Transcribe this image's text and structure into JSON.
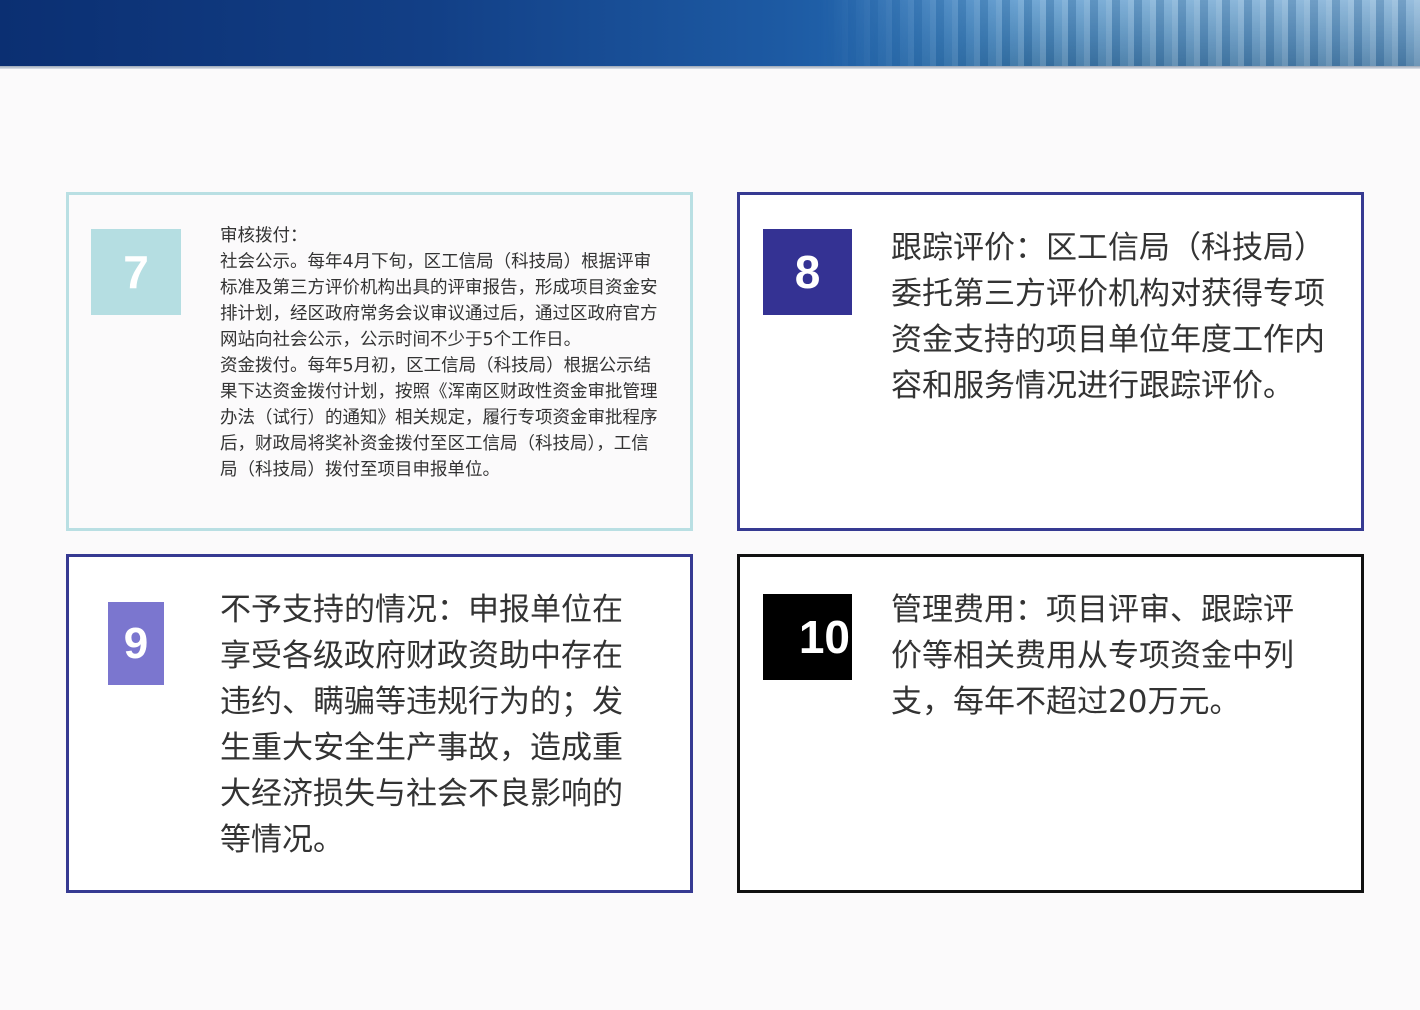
{
  "cards": [
    {
      "number": "7",
      "lines": [
        "审核拨付：",
        "社会公示。每年4月下旬，区工信局（科技局）根据评审标准及第三方评价机构出具的评审报告，形成项目资金安排计划，经区政府常务会议审议通过后，通过区政府官方网站向社会公示，公示时间不少于5个工作日。",
        "资金拨付。每年5月初，区工信局（科技局）根据公示结果下达资金拨付计划，按照《浑南区财政性资金审批管理办法（试行）的通知》相关规定，履行专项资金审批程序后，财政局将奖补资金拨付至区工信局（科技局），工信局（科技局）拨付至项目申报单位。"
      ],
      "badge_color": "#b5dee2",
      "border_color": "#b9dfe3"
    },
    {
      "number": "8",
      "text": "跟踪评价：区工信局（科技局）委托第三方评价机构对获得专项资金支持的项目单位年度工作内容和服务情况进行跟踪评价。",
      "badge_color": "#343293",
      "border_color": "#363a92"
    },
    {
      "number": "9",
      "text": "不予支持的情况：申报单位在享受各级政府财政资助中存在违约、瞒骗等违规行为的；发生重大安全生产事故，造成重大经济损失与社会不良影响的等情况。",
      "badge_color": "#7b76cf",
      "border_color": "#363a92"
    },
    {
      "number": "10",
      "text": "管理费用：项目评审、跟踪评价等相关费用从专项资金中列支，每年不超过20万元。",
      "badge_color": "#000000",
      "border_color": "#111111"
    }
  ]
}
